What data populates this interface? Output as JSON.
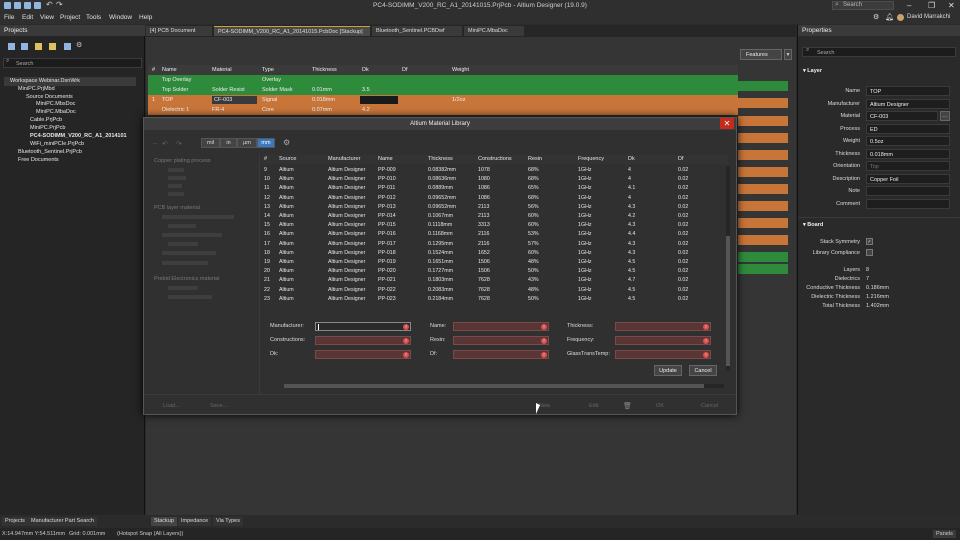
{
  "window": {
    "title": "PC4-SODIMM_V200_RC_A1_20141015.PrjPcb - Altium Designer (19.0.9)",
    "search_placeholder": "Search",
    "user": "David Marrakchi"
  },
  "menu": [
    "File",
    "Edit",
    "View",
    "Project",
    "Tools",
    "Window",
    "Help"
  ],
  "projects_panel": {
    "title": "Projects",
    "search_placeholder": "Search",
    "tree": [
      "Workspace Webinar.DsnWrk",
      "MiniPC.PrjMbd",
      "Source Documents",
      "MiniPC.MbsDoc",
      "MiniPC.MbaDoc",
      "Cable.PrjPcb",
      "MiniPC.PrjPcb",
      "PC4-SODIMM_V200_RC_A1_2014101",
      "WiFi_miniPCIe.PrjPcb",
      "Bluetooth_Sentinel.PrjPcb",
      "Free Documents"
    ]
  },
  "doc_tabs": [
    "[4] PCB Document",
    "PC4-SODIMM_V200_RC_A1_20141015.PcbDoc [Stackup]",
    "Bluetooth_Sentinel.PCBDwf",
    "MiniPC.MbaDoc"
  ],
  "features_button": "Features",
  "stackup": {
    "columns": [
      "#",
      "Name",
      "Material",
      "Type",
      "Thickness",
      "Dk",
      "Df",
      "Weight"
    ],
    "rows": [
      {
        "num": "",
        "name": "Top Overlay",
        "material": "",
        "type": "Overlay",
        "thickness": "",
        "dk": "",
        "df": "",
        "weight": ""
      },
      {
        "num": "",
        "name": "Top Solder",
        "material": "Solder Resist",
        "type": "Solder Mask",
        "thickness": "0.01mm",
        "dk": "3.5",
        "df": "",
        "weight": ""
      },
      {
        "num": "1",
        "name": "TOP",
        "material": "CF-003",
        "type": "Signal",
        "thickness": "0.018mm",
        "dk": "",
        "df": "",
        "weight": "1/2oz"
      },
      {
        "num": "",
        "name": "Dielectric 1",
        "material": "FR-4",
        "type": "Core",
        "thickness": "0.07mm",
        "dk": "4.2",
        "df": "",
        "weight": ""
      }
    ]
  },
  "dialog": {
    "title": "Altium Material Library",
    "units": [
      "mil",
      "in",
      "µm",
      "mm"
    ],
    "active_unit": "mm",
    "categories": [
      "Copper plating process",
      "PCB layer material",
      "Prebid Electronics material"
    ],
    "columns": [
      "#",
      "Source",
      "Manufacturer",
      "Name",
      "Thickness",
      "Constructions",
      "Resin",
      "Frequency",
      "Dk",
      "Df"
    ],
    "rows": [
      [
        "9",
        "Altium",
        "Altium Designer",
        "PP-009",
        "0.08382mm",
        "1078",
        "68%",
        "1GHz",
        "4",
        "0.02"
      ],
      [
        "10",
        "Altium",
        "Altium Designer",
        "PP-010",
        "0.08636mm",
        "1080",
        "68%",
        "1GHz",
        "4",
        "0.02"
      ],
      [
        "11",
        "Altium",
        "Altium Designer",
        "PP-011",
        "0.0889mm",
        "1086",
        "65%",
        "1GHz",
        "4.1",
        "0.02"
      ],
      [
        "12",
        "Altium",
        "Altium Designer",
        "PP-012",
        "0.09652mm",
        "1086",
        "68%",
        "1GHz",
        "4",
        "0.02"
      ],
      [
        "13",
        "Altium",
        "Altium Designer",
        "PP-013",
        "0.09652mm",
        "2113",
        "56%",
        "1GHz",
        "4.3",
        "0.02"
      ],
      [
        "14",
        "Altium",
        "Altium Designer",
        "PP-014",
        "0.1067mm",
        "2113",
        "60%",
        "1GHz",
        "4.2",
        "0.02"
      ],
      [
        "15",
        "Altium",
        "Altium Designer",
        "PP-015",
        "0.1118mm",
        "3313",
        "60%",
        "1GHz",
        "4.3",
        "0.02"
      ],
      [
        "16",
        "Altium",
        "Altium Designer",
        "PP-016",
        "0.1168mm",
        "2116",
        "53%",
        "1GHz",
        "4.4",
        "0.02"
      ],
      [
        "17",
        "Altium",
        "Altium Designer",
        "PP-017",
        "0.1295mm",
        "2116",
        "57%",
        "1GHz",
        "4.3",
        "0.02"
      ],
      [
        "18",
        "Altium",
        "Altium Designer",
        "PP-018",
        "0.1524mm",
        "1652",
        "60%",
        "1GHz",
        "4.3",
        "0.02"
      ],
      [
        "19",
        "Altium",
        "Altium Designer",
        "PP-019",
        "0.1651mm",
        "1506",
        "48%",
        "1GHz",
        "4.5",
        "0.02"
      ],
      [
        "20",
        "Altium",
        "Altium Designer",
        "PP-020",
        "0.1727mm",
        "1506",
        "50%",
        "1GHz",
        "4.5",
        "0.02"
      ],
      [
        "21",
        "Altium",
        "Altium Designer",
        "PP-021",
        "0.1803mm",
        "7628",
        "43%",
        "1GHz",
        "4.7",
        "0.02"
      ],
      [
        "22",
        "Altium",
        "Altium Designer",
        "PP-022",
        "0.2083mm",
        "7628",
        "48%",
        "1GHz",
        "4.5",
        "0.02"
      ],
      [
        "23",
        "Altium",
        "Altium Designer",
        "PP-023",
        "0.2184mm",
        "7628",
        "50%",
        "1GHz",
        "4.5",
        "0.02"
      ]
    ],
    "filters": {
      "manufacturer": "Manufacturer:",
      "constructions": "Constructions:",
      "dk": "Dk:",
      "name": "Name:",
      "resin": "Resin:",
      "df": "Df:",
      "thickness": "Thickness:",
      "frequency": "Frequency:",
      "glass": "GlassTransTemp:"
    },
    "update_button": "Update",
    "cancel_button": "Cancel",
    "footer": [
      "Load...",
      "Save...",
      "New",
      "Edit",
      "OK",
      "Cancel"
    ]
  },
  "properties": {
    "title": "Properties",
    "search_placeholder": "Search",
    "layer_section": "Layer",
    "layer": {
      "Name": "TOP",
      "Manufacturer": "Altium Designer",
      "Material": "CF-003",
      "Process": "ED",
      "Weight": "0.5oz",
      "Thickness": "0.018mm",
      "Orientation": "Top",
      "Description": "Copper Foil",
      "Note": "",
      "Comment": ""
    },
    "board_section": "Board",
    "board_checks": [
      "Stack Symmetry",
      "Library Compliance"
    ],
    "board": {
      "Layers": "8",
      "Dielectrics": "7",
      "Conductive Thickness": "0.186mm",
      "Dielectric Thickness": "1.216mm",
      "Total Thickness": "1.402mm"
    }
  },
  "bottom_tabs_left": [
    "Projects",
    "Manufacturer Part Search"
  ],
  "bottom_tabs_center": [
    "Stackup",
    "Impedance",
    "Via Types"
  ],
  "status": {
    "coords": "X:14.947mm Y:54.511mm",
    "grid": "Grid: 0.001mm",
    "snap": "(Hotspot Snap (All Layers))",
    "panels": "Panels"
  },
  "colors": {
    "green": "#2e8b3c",
    "orange": "#c8753a",
    "accent": "#3a78c0",
    "close": "#c42b1c"
  }
}
